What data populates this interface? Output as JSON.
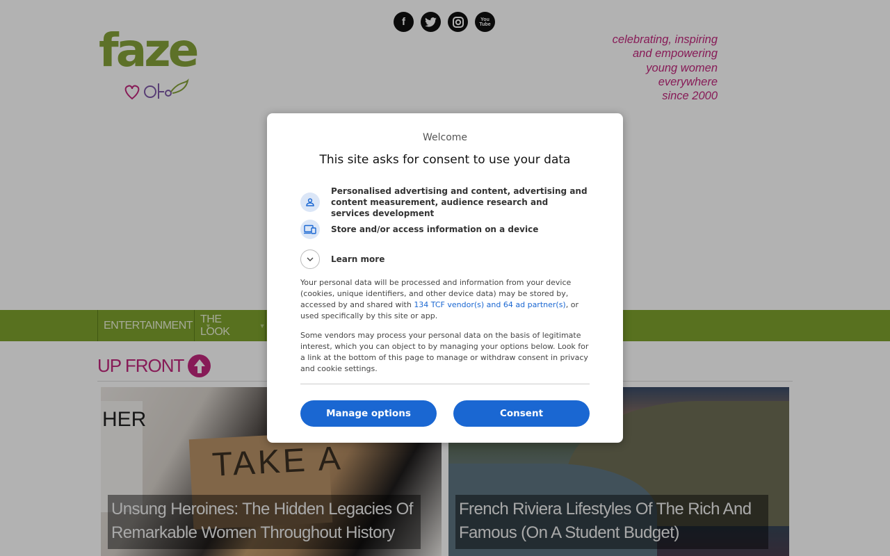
{
  "header": {
    "logo_text": "faze",
    "tagline": [
      "celebrating, inspiring",
      "and empowering",
      "young women",
      "everywhere",
      "since 2000"
    ],
    "social": [
      "facebook-icon",
      "twitter-icon",
      "instagram-icon",
      "youtube-icon"
    ],
    "youtube_label": "You Tube"
  },
  "nav": {
    "items": [
      {
        "label": "ENTERTAINMENT"
      },
      {
        "label": "THE LOOK"
      }
    ]
  },
  "section": {
    "title": "UP FRONT"
  },
  "cards": [
    {
      "title": "Unsung Heroines: The Hidden Legacies Of Remarkable Women Throughout History",
      "image_text_sign": "TAKE A",
      "image_text_sheet": "HER"
    },
    {
      "title": "French Riviera Lifestyles Of The Rich And Famous (On A Student Budget)"
    }
  ],
  "consent": {
    "welcome": "Welcome",
    "title": "This site asks for consent to use your data",
    "purposes": [
      "Personalised advertising and content, advertising and content measurement, audience research and services development",
      "Store and/or access information on a device"
    ],
    "learn_more": "Learn more",
    "para1_pre": "Your personal data will be processed and information from your device (cookies, unique identifiers, and other device data) may be stored by, accessed by and shared with ",
    "para1_link": "134 TCF vendor(s) and 64 ad partner(s)",
    "para1_post": ", or used specifically by this site or app.",
    "para2": "Some vendors may process your personal data on the basis of legitimate interest, which you can object to by managing your options below. Look for a link at the bottom of this page to manage or withdraw consent in privacy and cookie settings.",
    "manage_button": "Manage options",
    "consent_button": "Consent"
  },
  "colors": {
    "brand_green": "#7fa32d",
    "brand_pink": "#c2287d",
    "button_blue": "#1a67d2"
  }
}
